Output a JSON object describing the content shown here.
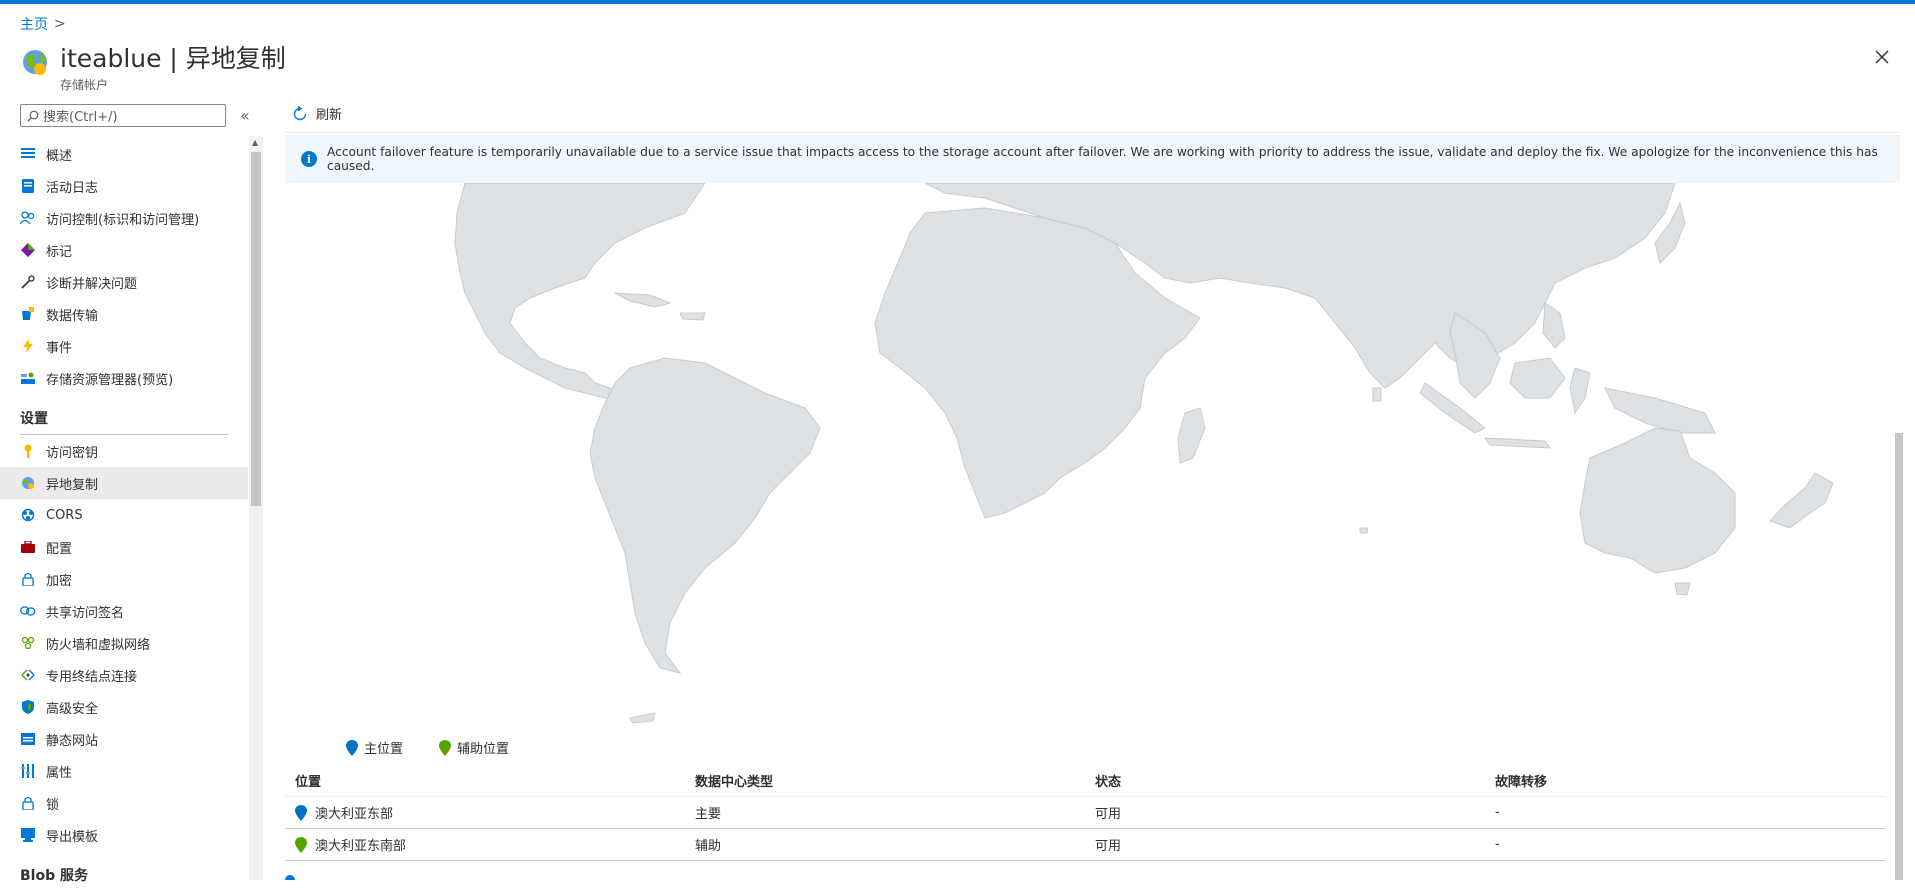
{
  "breadcrumb": {
    "home": "主页",
    "separator": ">"
  },
  "header": {
    "title": "iteablue | 异地复制",
    "subtitle": "存储帐户",
    "close_icon": "close-icon"
  },
  "sidebar": {
    "search_placeholder": "搜索(Ctrl+/)",
    "collapse_label": "«",
    "items": [
      {
        "label": "概述",
        "icon": "overview-icon",
        "color": "#0078d4"
      },
      {
        "label": "活动日志",
        "icon": "activity-log-icon",
        "color": "#0078d4"
      },
      {
        "label": "访问控制(标识和访问管理)",
        "icon": "iam-icon",
        "color": "#0078d4"
      },
      {
        "label": "标记",
        "icon": "tag-icon",
        "color": "#7719aa"
      },
      {
        "label": "诊断并解决问题",
        "icon": "wrench-icon",
        "color": "#323130"
      },
      {
        "label": "数据传输",
        "icon": "data-transfer-icon",
        "color": "#0078d4"
      },
      {
        "label": "事件",
        "icon": "lightning-icon",
        "color": "#ffb900"
      },
      {
        "label": "存储资源管理器(预览)",
        "icon": "storage-explorer-icon",
        "color": "#0078d4"
      }
    ],
    "section_settings": "设置",
    "settings_items": [
      {
        "label": "访问密钥",
        "icon": "key-icon",
        "color": "#ffb900"
      },
      {
        "label": "异地复制",
        "icon": "geo-replication-icon",
        "color": "#5ea0ef",
        "active": true
      },
      {
        "label": "CORS",
        "icon": "cors-icon",
        "color": "#0078d4"
      },
      {
        "label": "配置",
        "icon": "configuration-icon",
        "color": "#a80000"
      },
      {
        "label": "加密",
        "icon": "lock-icon",
        "color": "#0078d4"
      },
      {
        "label": "共享访问签名",
        "icon": "link-icon",
        "color": "#0078d4"
      },
      {
        "label": "防火墙和虚拟网络",
        "icon": "firewall-icon",
        "color": "#57a300"
      },
      {
        "label": "专用终结点连接",
        "icon": "endpoint-icon",
        "color": "#57a300"
      },
      {
        "label": "高级安全",
        "icon": "shield-icon",
        "color": "#0078d4"
      },
      {
        "label": "静态网站",
        "icon": "static-website-icon",
        "color": "#0078d4"
      },
      {
        "label": "属性",
        "icon": "properties-icon",
        "color": "#0078d4"
      },
      {
        "label": "锁",
        "icon": "lock-icon",
        "color": "#0078d4"
      },
      {
        "label": "导出模板",
        "icon": "export-template-icon",
        "color": "#0078d4"
      }
    ],
    "section_blob": "Blob 服务"
  },
  "toolbar": {
    "refresh_label": "刷新"
  },
  "banner": {
    "text": "Account failover feature is temporarily unavailable due to a service issue that impacts access to the storage account after failover. We are working with priority to address the issue, validate and deploy the fix. We apologize for the inconvenience this has caused."
  },
  "legend": {
    "primary": "主位置",
    "secondary": "辅助位置"
  },
  "colors": {
    "primary_pin": "#0072c6",
    "secondary_pin": "#57a300",
    "land": "#dfe2e5",
    "accent": "#0078d4"
  },
  "table": {
    "headers": [
      "位置",
      "数据中心类型",
      "状态",
      "故障转移"
    ],
    "rows": [
      {
        "location": "澳大利亚东部",
        "type": "主要",
        "status": "可用",
        "failover": "-",
        "pin": "primary"
      },
      {
        "location": "澳大利亚东南部",
        "type": "辅助",
        "status": "可用",
        "failover": "-",
        "pin": "secondary"
      }
    ]
  }
}
